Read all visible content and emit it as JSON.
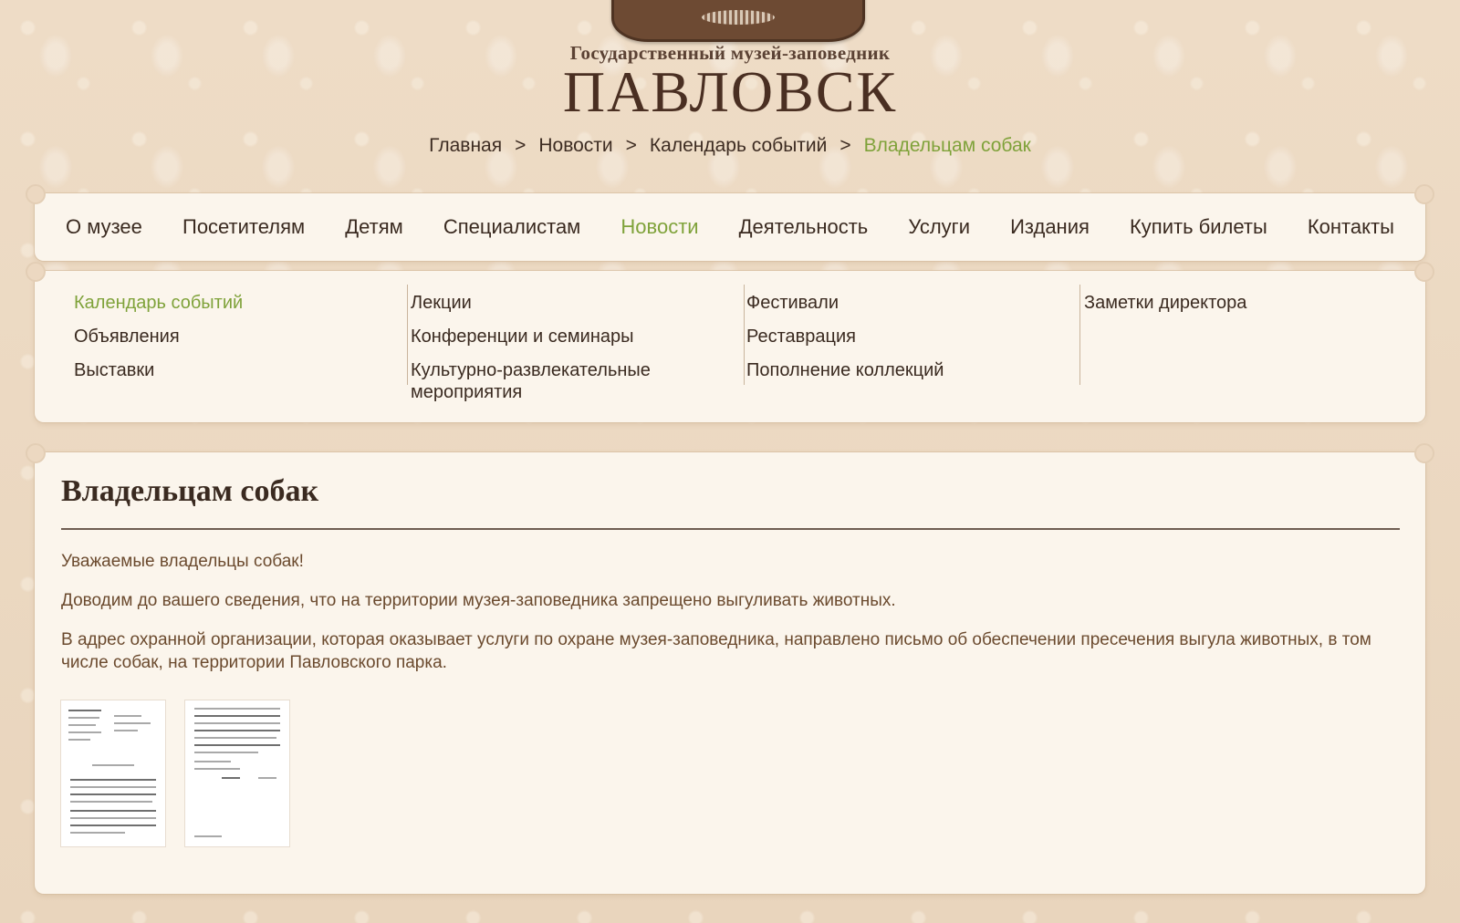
{
  "header": {
    "logo_subtitle": "Государственный музей-заповедник",
    "logo_title": "ПАВЛОВСК"
  },
  "breadcrumb": {
    "items": [
      "Главная",
      "Новости",
      "Календарь событий",
      "Владельцам собак"
    ],
    "separator": ">"
  },
  "nav": {
    "items": [
      "О музее",
      "Посетителям",
      "Детям",
      "Специалистам",
      "Новости",
      "Деятельность",
      "Услуги",
      "Издания",
      "Купить билеты",
      "Контакты"
    ],
    "active": "Новости"
  },
  "submenu": {
    "col1": [
      "Календарь событий",
      "Объявления",
      "Выставки"
    ],
    "col2": [
      "Лекции",
      "Конференции и семинары",
      "Культурно-развлекательные мероприятия"
    ],
    "col3": [
      "Фестивали",
      "Реставрация",
      "Пополнение коллекций"
    ],
    "col4": [
      "Заметки директора"
    ],
    "active": "Календарь событий"
  },
  "article": {
    "title": "Владельцам собак",
    "paragraphs": [
      "Уважаемые владельцы собак!",
      "Доводим до вашего сведения, что на территории музея-заповедника запрещено выгуливать животных.",
      "В адрес охранной организации, которая оказывает услуги по охране музея-заповедника, направлено письмо об обеспечении пресечения выгула животных, в том числе собак, на территории Павловского парка."
    ],
    "attachments": [
      "document-thumbnail-1",
      "document-thumbnail-2"
    ]
  },
  "colors": {
    "accent_green": "#7fa23a",
    "text_brown": "#3a2a20",
    "body_text": "#6b4a2e",
    "panel_bg": "#fbf5ec",
    "page_bg": "#ecd9c2"
  }
}
